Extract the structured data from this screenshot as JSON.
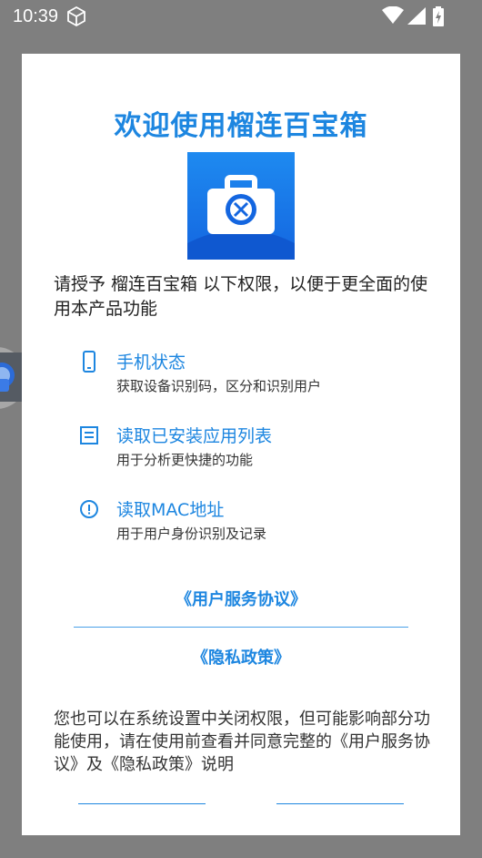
{
  "status_bar": {
    "time": "10:39"
  },
  "dialog": {
    "title": "欢迎使用榴连百宝箱",
    "intro": "请授予 榴连百宝箱 以下权限，以便于更全面的使用本产品功能",
    "permissions": [
      {
        "icon": "phone-icon",
        "title": "手机状态",
        "desc": "获取设备识别码，区分和识别用户"
      },
      {
        "icon": "list-icon",
        "title": "读取已安装应用列表",
        "desc": "用于分析更快捷的功能"
      },
      {
        "icon": "info-icon",
        "title": "读取MAC地址",
        "desc": "用于用户身份识别及记录"
      }
    ],
    "user_agreement_link": "《用户服务协议》",
    "privacy_policy_link": "《隐私政策》",
    "footer_text": "您也可以在系统设置中关闭权限，但可能影响部分功能使用，请在使用前查看并同意完整的《用户服务协议》及《隐私政策》说明"
  },
  "colors": {
    "accent": "#1d86e0",
    "scrim": "#7f7f7f"
  }
}
